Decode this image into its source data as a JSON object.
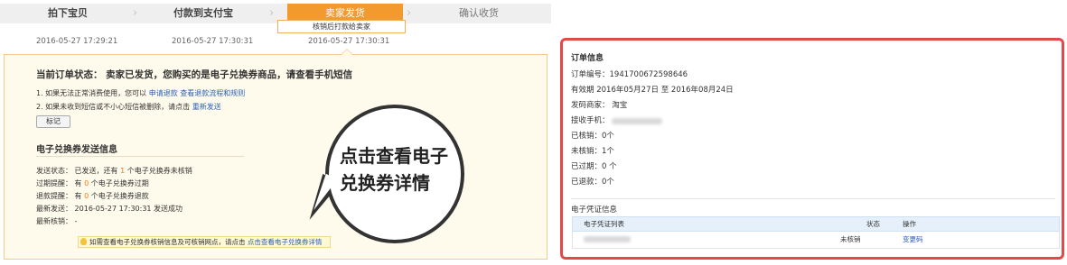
{
  "steps": [
    {
      "label": "拍下宝贝",
      "time": "2016-05-27 17:29:21"
    },
    {
      "label": "付款到支付宝",
      "time": "2016-05-27 17:30:31"
    },
    {
      "label": "卖家发货",
      "time": "2016-05-27 17:30:31"
    },
    {
      "label": "确认收货"
    }
  ],
  "step_tip": "核销后打款给卖家",
  "status": {
    "label": "当前订单状态：",
    "text": "卖家已发货，您购买的是电子兑换券商品，请查看手机短信"
  },
  "hints": {
    "line1_prefix": "1. 如果无法正常消费使用，您可以",
    "line1_link1": "申请退款",
    "line1_link2": "查看退款流程和规则",
    "line2_prefix": "2. 如果未收到短信或不小心短信被删除，请点击",
    "line2_link": "重新发送"
  },
  "mark_button": "标记",
  "send_section": {
    "title": "电子兑换券发送信息",
    "send_status_label": "发送状态：",
    "send_status_pre": "已发送，还有",
    "send_status_count": "1",
    "send_status_post": "个电子兑换券未核销",
    "expire_label": "过期提醒：",
    "expire_pre": "有",
    "expire_count": "0",
    "expire_post": "个电子兑换券过期",
    "refund_label": "退款提醒：",
    "refund_pre": "有",
    "refund_count": "0",
    "refund_post": "个电子兑换券退款",
    "latest_send_label": "最新发送：",
    "latest_send_value": "2016-05-27 17:30:31 发送成功",
    "latest_verify_label": "最新核销：",
    "latest_verify_value": "-"
  },
  "tip_bar": {
    "text": "如需查看电子兑换券核销信息及可核销网点，请点击",
    "link": "点击查看电子兑换券详情"
  },
  "bubble": {
    "line1": "点击查看电子",
    "line2": "兑换券详情"
  },
  "order_info": {
    "title": "订单信息",
    "order_no_label": "订单编号：",
    "order_no": "1941700672598646",
    "validity_label": "有效期",
    "validity_from": "2016年05月27日",
    "validity_to_label": "至",
    "validity_to": "2016年08月24日",
    "merchant_label": "发码商家：",
    "merchant": "淘宝",
    "phone_label": "接收手机：",
    "verified_label": "已核销：",
    "verified": "0个",
    "unverified_label": "未核销：",
    "unverified": "1个",
    "expired_label": "已过期：",
    "expired": "0 个",
    "refunded_label": "已退款：",
    "refunded": "0个"
  },
  "voucher_section": {
    "title": "电子凭证信息",
    "columns": [
      "电子凭证列表",
      "状态",
      "操作"
    ],
    "rows": [
      {
        "status": "未核销",
        "action": "变更码"
      }
    ]
  },
  "colors": {
    "active_step": "#f29a2e",
    "link": "#2a5fb5",
    "highlight_border": "#e04a4a",
    "count_orange": "#f07a1a"
  }
}
